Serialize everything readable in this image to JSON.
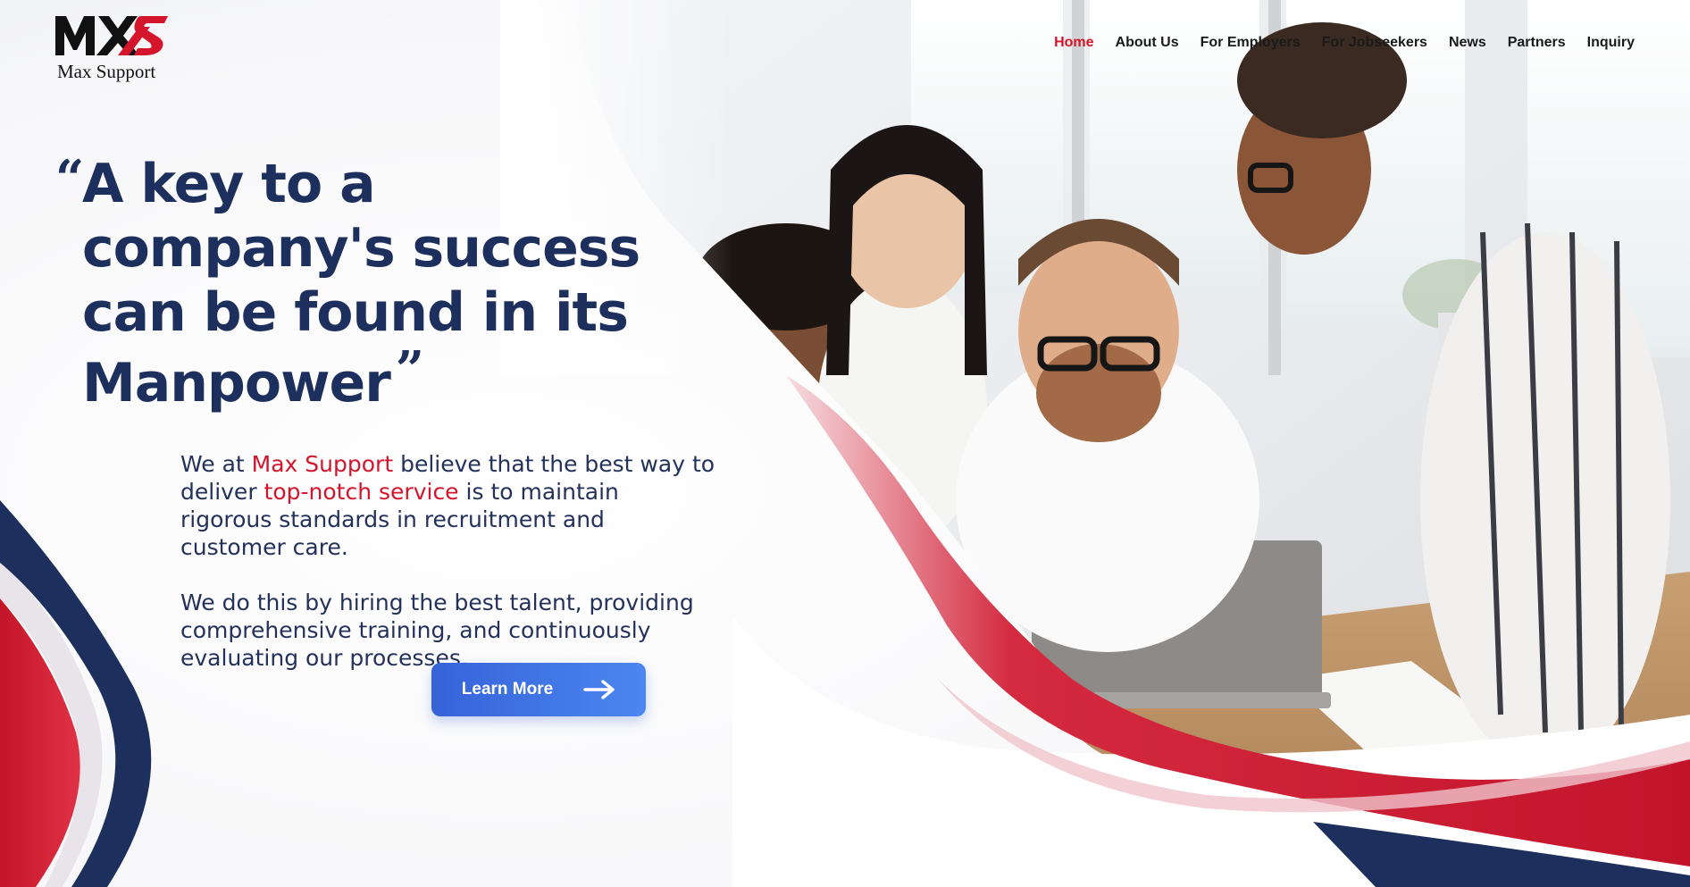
{
  "brand": {
    "name": "Max Support",
    "logo_icon": "mxs-logo-mark",
    "colors": {
      "primary_navy": "#1d2f5c",
      "accent_red": "#d4152b",
      "button_blue": "#3f74e6"
    }
  },
  "nav": {
    "items": [
      {
        "label": "Home",
        "active": true
      },
      {
        "label": "About Us",
        "active": false
      },
      {
        "label": "For Employers",
        "active": false
      },
      {
        "label": "For Jobseekers",
        "active": false
      },
      {
        "label": "News",
        "active": false
      },
      {
        "label": "Partners",
        "active": false
      },
      {
        "label": "Inquiry",
        "active": false
      }
    ]
  },
  "hero": {
    "quote_open": "“",
    "title_lines": [
      "A key to a",
      "company's success",
      "can be found in its",
      "Manpower"
    ],
    "quote_close": "”",
    "paragraph1": {
      "part1": "We at ",
      "brand": "Max Support",
      "part2": " believe that the best way to deliver ",
      "highlight": "top-notch service",
      "part3": " is to maintain rigorous standards in recruitment and customer care."
    },
    "paragraph2": "We do this by hiring the best talent, providing comprehensive training, and continuously evaluating our processes.",
    "cta": {
      "label": "Learn More",
      "icon": "arrow-right-icon"
    },
    "image": {
      "subject": "team-photo",
      "icon": "team-photo-illustration"
    }
  }
}
